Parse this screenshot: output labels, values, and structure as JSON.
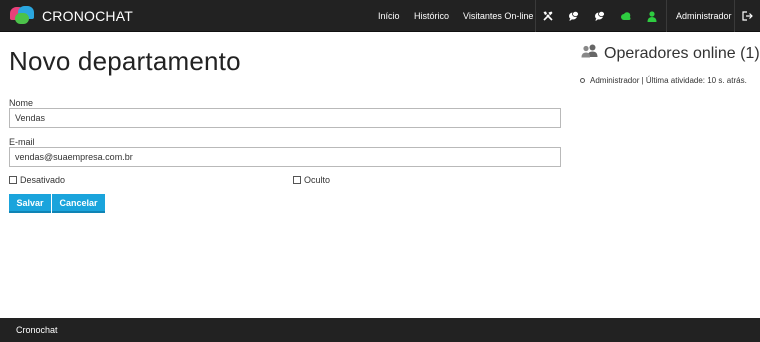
{
  "app": {
    "brand": "CRONOCHAT"
  },
  "nav": {
    "links": [
      "Início",
      "Histórico",
      "Visitantes On-line"
    ],
    "icons": [
      "tools-icon",
      "chat-bubbles-icon",
      "chat-bubbles-icon",
      "cloud-icon",
      "user-icon"
    ],
    "user": "Administrador",
    "logout_icon": "logout-icon",
    "accent_green": "#2ecc40"
  },
  "main": {
    "title": "Novo departamento",
    "name_label": "Nome",
    "name_value": "Vendas",
    "email_label": "E-mail",
    "email_value": "vendas@suaempresa.com.br",
    "disabled_label": "Desativado",
    "hidden_label": "Oculto",
    "save_label": "Salvar",
    "cancel_label": "Cancelar",
    "button_color": "#1aa4dc"
  },
  "sidebar": {
    "title": "Operadores online (1)",
    "operators": [
      "Administrador | Última atividade: 10 s. atrás."
    ]
  },
  "footer": {
    "text": "Cronochat"
  }
}
